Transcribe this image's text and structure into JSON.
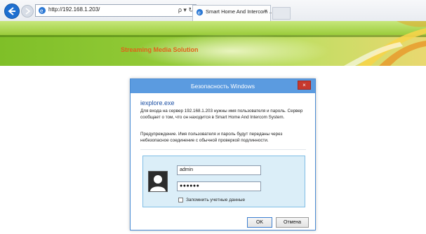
{
  "browser": {
    "url": "http://192.168.1.203/",
    "address_tools": "ρ ▾ ↻",
    "tab_title": "Smart Home And Intercom ...",
    "tab_close": "×"
  },
  "page": {
    "banner_title": "Streaming Media Solution"
  },
  "dialog": {
    "title": "Безопасность Windows",
    "close_label": "×",
    "app_name": "iexplore.exe",
    "message": "Для входа на сервер 192.168.1.203 нужны имя пользователя и пароль. Сервер сообщает о том, что он находится в Smart Home And Intercom System.",
    "warning": "Предупреждение. Имя пользователя и пароль будут переданы через небезопасное соединение с обычной проверкой подлинности.",
    "username_value": "admin",
    "password_value": "●●●●●●",
    "remember_label": "Запомнить учетные данные",
    "ok_label": "OK",
    "cancel_label": "Отмена"
  },
  "colors": {
    "accent": "#5b9be0",
    "banner_green": "#8cc63f",
    "banner_title": "#e0621a"
  }
}
